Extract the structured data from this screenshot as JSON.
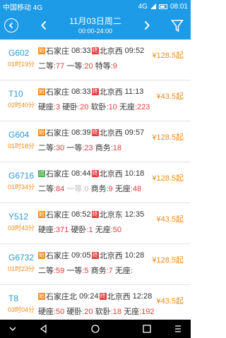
{
  "status": {
    "carrier": "中国移动 4G",
    "net": "4G",
    "time": "08:01"
  },
  "header": {
    "date": "11月03日周二",
    "time_range": "00:00-24:00"
  },
  "trains": [
    {
      "no": "G602",
      "duration": "01时19分",
      "from": "石家庄",
      "dep": "08:33",
      "to": "北京西",
      "arr": "09:52",
      "price": "¥128.5起",
      "seats": [
        [
          "二等",
          ":77"
        ],
        [
          "一等",
          ":20"
        ],
        [
          "特等",
          ":9"
        ]
      ]
    },
    {
      "no": "T10",
      "duration": "02时40分",
      "from": "石家庄",
      "dep": "08:33",
      "to": "北京西",
      "arr": "11:13",
      "price": "¥43.5起",
      "seats": [
        [
          "硬座",
          ":3"
        ],
        [
          "硬卧",
          ":20"
        ],
        [
          "软卧",
          ":10"
        ],
        [
          "无座",
          ":223"
        ]
      ]
    },
    {
      "no": "G604",
      "duration": "01时18分",
      "from": "石家庄",
      "dep": "08:39",
      "to": "北京西",
      "arr": "09:57",
      "price": "¥128.5起",
      "seats": [
        [
          "二等",
          ":30"
        ],
        [
          "一等",
          ":23"
        ],
        [
          "商务",
          ":18"
        ]
      ]
    },
    {
      "no": "G6716",
      "duration": "01时34分",
      "from": "石家庄",
      "dep": "08:44",
      "to": "北京西",
      "arr": "10:18",
      "price": "¥128.5起",
      "seats": [
        [
          "二等",
          ":84"
        ],
        [
          "一等",
          ":0"
        ],
        [
          "商务",
          ":9"
        ],
        [
          "无座",
          ":48"
        ]
      ]
    },
    {
      "no": "Y512",
      "duration": "03时43分",
      "from": "石家庄",
      "dep": "08:52",
      "to": "北京东",
      "arr": "12:35",
      "price": "¥43.5起",
      "seats": [
        [
          "硬座",
          ":371"
        ],
        [
          "硬卧",
          ":1"
        ],
        [
          "无座",
          ":50"
        ]
      ]
    },
    {
      "no": "G6732",
      "duration": "01时23分",
      "from": "石家庄",
      "dep": "09:05",
      "to": "北京西",
      "arr": "10:28",
      "price": "¥128.5起",
      "seats": [
        [
          "二等",
          ":59"
        ],
        [
          "一等",
          ":5"
        ],
        [
          "商务",
          ":7"
        ],
        [
          "无座",
          ":"
        ]
      ]
    },
    {
      "no": "T8",
      "duration": "03时04分",
      "from": "石家庄北",
      "dep": "09:24",
      "to": "北京西",
      "arr": "12:28",
      "price": "¥43.5起",
      "seats": [
        [
          "硬座",
          ":50"
        ],
        [
          "硬卧",
          ":20"
        ],
        [
          "软卧",
          ":18"
        ],
        [
          "无座",
          ":192"
        ]
      ]
    }
  ],
  "badges": {
    "start": "始",
    "pass": "过",
    "end": "终"
  },
  "colors": {
    "primary": "#1e9be6",
    "price": "#f08a1c",
    "count": "#e33b3b",
    "train_no": "#2a9ad8"
  },
  "icons": [
    "back-icon",
    "prev-day-icon",
    "next-day-icon",
    "filter-icon",
    "nav-hide-icon",
    "nav-back-icon",
    "nav-home-icon",
    "nav-recent-icon",
    "nav-menu-icon"
  ]
}
